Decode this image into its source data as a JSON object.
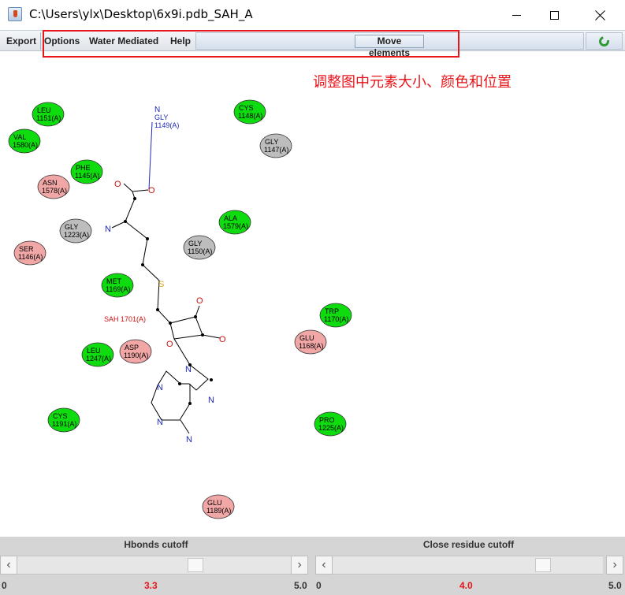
{
  "window": {
    "title": "C:\\Users\\ylx\\Desktop\\6x9i.pdb_SAH_A"
  },
  "menu": {
    "export": "Export",
    "options": "Options",
    "water": "Water Mediated",
    "help": "Help",
    "move_elements": "Move elements"
  },
  "annotation": {
    "text": "调整图中元素大小、颜色和位置",
    "color": "#e8151b"
  },
  "ligand": {
    "label": "SAH 1701(A)"
  },
  "colors": {
    "hydrophobic": "#0fdc0f",
    "polar": "#f2a7a7",
    "glycine": "#bdbdbd",
    "hbond": "#1d2ab8",
    "ligand_label": "#cc1111"
  },
  "residues": [
    {
      "name": "LEU",
      "num": "1151(A)",
      "kind": "hydrophobic"
    },
    {
      "name": "VAL",
      "num": "1580(A)",
      "kind": "hydrophobic"
    },
    {
      "name": "PHE",
      "num": "1145(A)",
      "kind": "hydrophobic"
    },
    {
      "name": "ASN",
      "num": "1578(A)",
      "kind": "polar"
    },
    {
      "name": "GLY",
      "num": "1223(A)",
      "kind": "glycine"
    },
    {
      "name": "SER",
      "num": "1146(A)",
      "kind": "polar"
    },
    {
      "name": "MET",
      "num": "1169(A)",
      "kind": "hydrophobic"
    },
    {
      "name": "LEU",
      "num": "1247(A)",
      "kind": "hydrophobic"
    },
    {
      "name": "ASP",
      "num": "1190(A)",
      "kind": "polar"
    },
    {
      "name": "CYS",
      "num": "1191(A)",
      "kind": "hydrophobic"
    },
    {
      "name": "CYS",
      "num": "1148(A)",
      "kind": "hydrophobic"
    },
    {
      "name": "GLY",
      "num": "1147(A)",
      "kind": "glycine"
    },
    {
      "name": "ALA",
      "num": "1579(A)",
      "kind": "hydrophobic"
    },
    {
      "name": "GLY",
      "num": "1150(A)",
      "kind": "glycine"
    },
    {
      "name": "TRP",
      "num": "1170(A)",
      "kind": "hydrophobic"
    },
    {
      "name": "GLU",
      "num": "1168(A)",
      "kind": "polar"
    },
    {
      "name": "PRO",
      "num": "1225(A)",
      "kind": "hydrophobic"
    },
    {
      "name": "GLU",
      "num": "1189(A)",
      "kind": "polar"
    }
  ],
  "hbond_partner": {
    "atom": "N",
    "name": "GLY",
    "num": "1149(A)"
  },
  "atoms": {
    "O": "O",
    "N": "N",
    "S": "S"
  },
  "hbonds": {
    "title": "Hbonds cutoff",
    "min": "0",
    "max": "5.0",
    "value": "3.3"
  },
  "close": {
    "title": "Close residue cutoff",
    "min": "0",
    "max": "5.0",
    "value": "4.0"
  }
}
